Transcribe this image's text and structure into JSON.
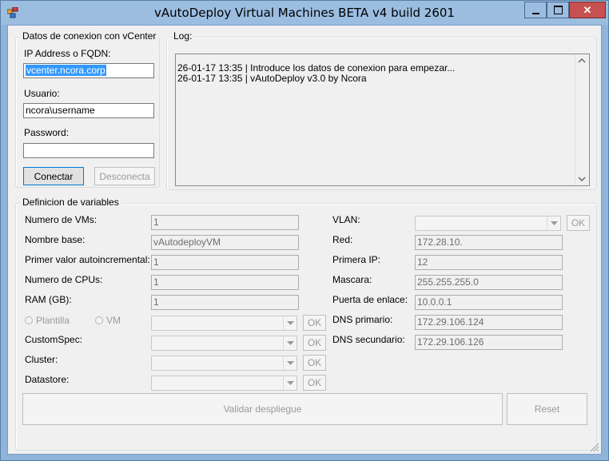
{
  "window": {
    "title": "vAutoDeploy Virtual Machines BETA v4 build 2601",
    "min_glyph": "▁",
    "max_glyph": "☐",
    "close_glyph": "✕"
  },
  "connection": {
    "legend": "Datos de conexion con vCenter",
    "ip_label": "IP Address o FQDN:",
    "ip_value": "vcenter.ncora.corp",
    "user_label": "Usuario:",
    "user_value": "ncora\\username",
    "password_label": "Password:",
    "password_value": "",
    "connect_button": "Conectar",
    "disconnect_button": "Desconecta"
  },
  "log": {
    "legend": "Log:",
    "lines": [
      "26-01-17 13:35 |  Introduce los datos de conexion para empezar...",
      "26-01-17 13:35 |  vAutoDeploy v3.0 by Ncora"
    ]
  },
  "variables": {
    "legend": "Definicion de variables",
    "num_vms_label": "Numero de VMs:",
    "num_vms_value": "1",
    "base_name_label": "Nombre base:",
    "base_name_value": "vAutodeployVM",
    "first_autoinc_label": "Primer valor autoincremental:",
    "first_autoinc_value": "1",
    "cpus_label": "Numero de CPUs:",
    "cpus_value": "1",
    "ram_label": "RAM (GB):",
    "ram_value": "1",
    "radio_template": "Plantilla",
    "radio_vm": "VM",
    "customspec_label": "CustomSpec:",
    "cluster_label": "Cluster:",
    "datastore_label": "Datastore:",
    "ok_label": "OK",
    "vlan_label": "VLAN:",
    "red_label": "Red:",
    "red_value": "172.28.10.",
    "first_ip_label": "Primera IP:",
    "first_ip_value": "12",
    "mask_label": "Mascara:",
    "mask_value": "255.255.255.0",
    "gateway_label": "Puerta de enlace:",
    "gateway_value": "10.0.0.1",
    "dns1_label": "DNS primario:",
    "dns1_value": "172.29.106.124",
    "dns2_label": "DNS secundario:",
    "dns2_value": "172.29.106.126",
    "validate_button": "Validar despliegue",
    "reset_button": "Reset"
  },
  "colors": {
    "title_bg": "#9bbde0",
    "close_bg": "#c75050",
    "selection": "#3399ff"
  }
}
